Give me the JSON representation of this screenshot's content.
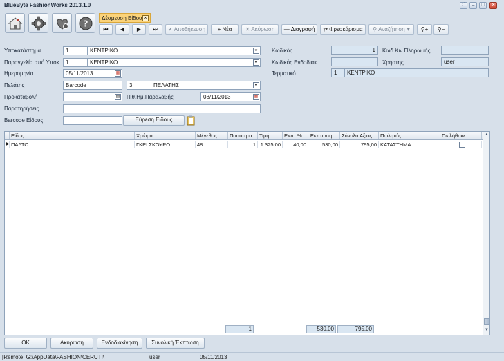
{
  "app": {
    "title": "BlueByte FashionWorks 2013.1.0"
  },
  "window_controls": [
    "expand-icon",
    "minimize-icon",
    "maximize-icon",
    "close-icon"
  ],
  "big_buttons": [
    "home-icon",
    "gear-icon",
    "heart-icon",
    "help-icon"
  ],
  "tab": {
    "label": "Δέσμευση Είδους",
    "close": "×"
  },
  "toolbar": {
    "first": "⏮",
    "prev": "◀",
    "next": "▶",
    "last": "⏭",
    "save": "Αποθήκευση",
    "new": "Νέα",
    "cancel": "Ακύρωση",
    "delete": "Διαγραφή",
    "refresh": "Φρεσκάρισμα",
    "search": "Αναζήτηση"
  },
  "form": {
    "branch": {
      "label": "Υποκατάστημα",
      "code": "1",
      "name": "ΚΕΝΤΡΙΚΟ"
    },
    "order_from_branch": {
      "label": "Παραγγελία από Υποκ",
      "code": "1",
      "name": "ΚΕΝΤΡΙΚΟ"
    },
    "date": {
      "label": "Ημερομηνία",
      "value": "05/11/2013"
    },
    "customer": {
      "label": "Πελάτης",
      "barcode": "Barcode",
      "code": "3",
      "name": "ΠΕΛΑΤΗΣ"
    },
    "advance": {
      "label": "Προκαταβολή",
      "value": ""
    },
    "expected_delivery": {
      "label": "Πιθ.Ημ.Παραλαβής",
      "value": "08/11/2013"
    },
    "notes": {
      "label": "Παρατηρήσεις",
      "value": ""
    },
    "item_barcode": {
      "label": "Barcode Είδους",
      "value": "",
      "find_button": "Εύρεση Είδους"
    },
    "code": {
      "label": "Κωδικός",
      "value": "1"
    },
    "payment_code": {
      "label": "Κωδ.Κιν.Πληρωμής",
      "value": ""
    },
    "internal_code": {
      "label": "Κωδικός Ενδοδιακ.",
      "value": ""
    },
    "user": {
      "label": "Χρήστης",
      "value": "user"
    },
    "terminal": {
      "label": "Τερματικό",
      "code": "1",
      "name": "ΚΕΝΤΡΙΚΟ"
    }
  },
  "grid": {
    "columns": [
      "Είδος",
      "Χρώμα",
      "Μέγεθος",
      "Ποσότητα",
      "Τιμή",
      "Εκπτ.%",
      "Έκπτωση",
      "Σύνολο Αξίας",
      "Πωλητής",
      "Πωλήθηκε"
    ],
    "rows": [
      {
        "item": "ΠΑΛΤΟ",
        "color": "ΓΚΡΙ ΣΚΟΥΡΟ",
        "size": "48",
        "qty": "1",
        "price": "1.325,00",
        "disc_pct": "40,00",
        "discount": "530,00",
        "total": "795,00",
        "seller": "ΚΑΤΑΣΤΗΜΑ",
        "sold": false
      }
    ],
    "totals": {
      "qty": "1",
      "discount": "530,00",
      "total": "795,00"
    }
  },
  "buttons": {
    "ok": "OK",
    "cancel": "Ακύρωση",
    "internal": "Ενδοδιακίνηση",
    "total_discount": "Συνολική Έκπτωση"
  },
  "status": {
    "path": "[Remote] G:\\AppData\\FASHION\\CERUTI\\",
    "user": "user",
    "date": "05/11/2013"
  }
}
